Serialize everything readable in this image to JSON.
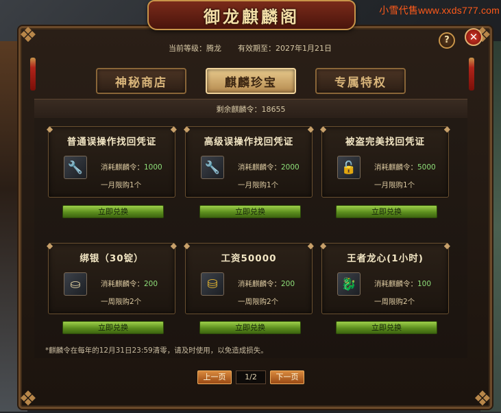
{
  "watermark": "小雪代售www.xxds777.com",
  "title": "御龙麒麟阁",
  "help_label": "?",
  "close_label": "✕",
  "info": {
    "level_label": "当前等级：",
    "level_value": "腾龙",
    "expire_label": "有效期至：",
    "expire_value": "2027年1月21日"
  },
  "tabs": [
    {
      "label": "神秘商店",
      "active": false
    },
    {
      "label": "麒麟珍宝",
      "active": true
    },
    {
      "label": "专属特权",
      "active": false
    }
  ],
  "remaining": {
    "label": "剩余麒麟令：",
    "value": "18655"
  },
  "cost_label": "消耗麒麟令：",
  "exchange_label": "立即兑换",
  "items": [
    {
      "title": "普通误操作找回凭证",
      "icon": "wrench-icon",
      "cost": "1000",
      "limit": "一月限购1个"
    },
    {
      "title": "高级误操作找回凭证",
      "icon": "wrench-icon",
      "cost": "2000",
      "limit": "一月限购1个"
    },
    {
      "title": "被盗完美找回凭证",
      "icon": "padlock-icon",
      "cost": "5000",
      "limit": "一月限购1个"
    },
    {
      "title": "绑银（30锭）",
      "icon": "silver-ingot-icon",
      "cost": "200",
      "limit": "一周限购2个"
    },
    {
      "title": "工资50000",
      "icon": "gold-ingot-icon",
      "cost": "200",
      "limit": "一周限购2个"
    },
    {
      "title": "王者龙心(1小时)",
      "icon": "dragon-heart-icon",
      "cost": "100",
      "limit": "一周限购2个"
    }
  ],
  "footnote": "*麒麟令在每年的12月31日23:59清零，请及时使用，以免造成损失。",
  "pager": {
    "prev": "上一页",
    "page": "1/2",
    "next": "下一页"
  },
  "colors": {
    "cost_value": "#8fe07a",
    "exchange_button": "#6a9a24",
    "page_button": "#c06a28",
    "title_text": "#f4dfa7"
  }
}
